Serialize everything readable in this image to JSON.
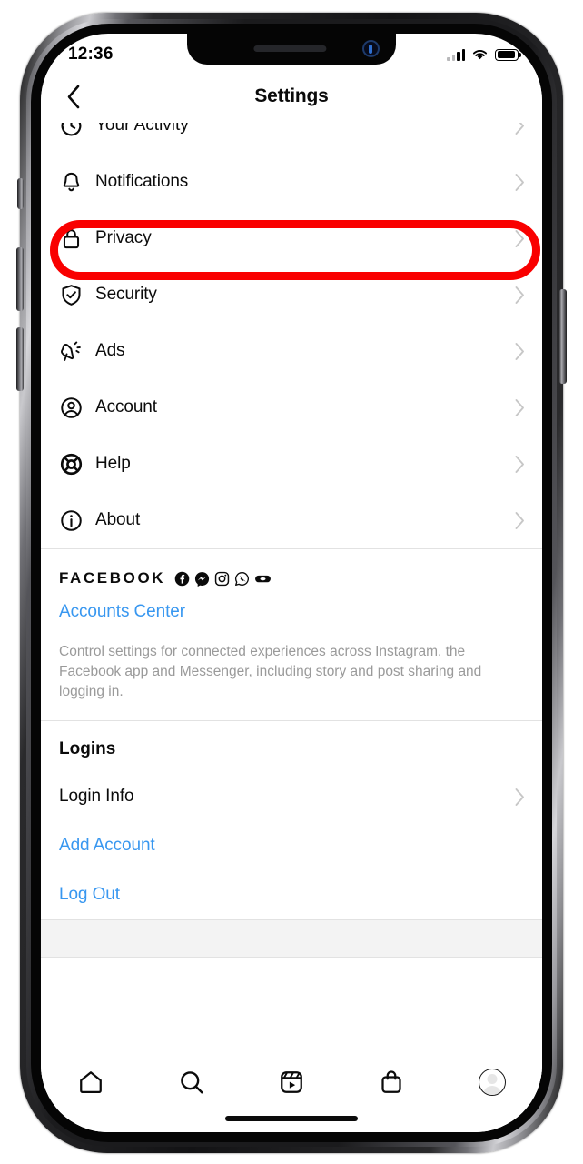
{
  "device": {
    "status_bar": {
      "time": "12:36",
      "signal_icon": "cellular-signal-icon",
      "wifi_icon": "wifi-icon",
      "battery_icon": "battery-icon"
    },
    "home_indicator": "home-indicator"
  },
  "header": {
    "title": "Settings",
    "back_icon": "chevron-left-icon"
  },
  "settings_list": [
    {
      "label": "Your Activity",
      "icon": "activity-clock-icon",
      "chevron": "chevron-right-icon",
      "clipped": true
    },
    {
      "label": "Notifications",
      "icon": "bell-icon",
      "chevron": "chevron-right-icon"
    },
    {
      "label": "Privacy",
      "icon": "lock-icon",
      "chevron": "chevron-right-icon"
    },
    {
      "label": "Security",
      "icon": "shield-check-icon",
      "chevron": "chevron-right-icon"
    },
    {
      "label": "Ads",
      "icon": "megaphone-icon",
      "chevron": "chevron-right-icon"
    },
    {
      "label": "Account",
      "icon": "account-circle-icon",
      "chevron": "chevron-right-icon"
    },
    {
      "label": "Help",
      "icon": "lifebuoy-icon",
      "chevron": "chevron-right-icon"
    },
    {
      "label": "About",
      "icon": "info-circle-icon",
      "chevron": "chevron-right-icon"
    }
  ],
  "facebook_section": {
    "heading": "FACEBOOK",
    "brand_icons": [
      "facebook-icon",
      "messenger-icon",
      "instagram-icon",
      "whatsapp-icon",
      "oculus-icon"
    ],
    "link_label": "Accounts Center",
    "description": "Control settings for connected experiences across Instagram, the Facebook app and Messenger, including story and post sharing and logging in."
  },
  "logins_section": {
    "title": "Logins",
    "items": [
      {
        "label": "Login Info",
        "type": "nav",
        "chevron": "chevron-right-icon",
        "highlighted": false
      },
      {
        "label": "Add Account",
        "type": "link",
        "chevron": "",
        "highlighted": true
      },
      {
        "label": "Log Out",
        "type": "link",
        "chevron": "",
        "highlighted": false
      }
    ]
  },
  "tab_bar": {
    "tabs": [
      {
        "name": "home",
        "icon": "home-icon"
      },
      {
        "name": "search",
        "icon": "search-icon"
      },
      {
        "name": "reels",
        "icon": "reels-icon"
      },
      {
        "name": "shop",
        "icon": "shopping-bag-icon"
      },
      {
        "name": "profile",
        "icon": "profile-avatar-icon"
      }
    ]
  },
  "colors": {
    "link_blue": "#3897f0",
    "highlight_red": "#f90000",
    "text_primary": "#0b0b0b",
    "text_muted": "#9a9a9a",
    "divider": "#dcdcdc"
  }
}
